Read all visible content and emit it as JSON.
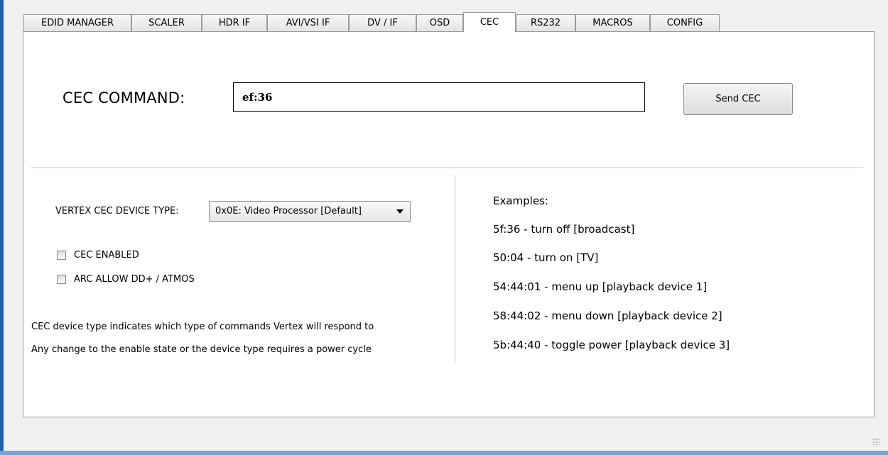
{
  "tabs": [
    {
      "label": "EDID MANAGER"
    },
    {
      "label": "SCALER"
    },
    {
      "label": "HDR IF"
    },
    {
      "label": "AVI/VSI IF"
    },
    {
      "label": "DV / IF"
    },
    {
      "label": "OSD"
    },
    {
      "label": "CEC",
      "active": true
    },
    {
      "label": "RS232"
    },
    {
      "label": "MACROS"
    },
    {
      "label": "CONFIG"
    }
  ],
  "cec_command": {
    "label": "CEC COMMAND:",
    "value": "ef:36",
    "send_label": "Send CEC"
  },
  "device_type": {
    "label": "VERTEX CEC DEVICE TYPE:",
    "selected": "0x0E: Video Processor [Default]"
  },
  "checkboxes": [
    {
      "label": "CEC ENABLED",
      "checked": false
    },
    {
      "label": "ARC ALLOW DD+ / ATMOS",
      "checked": false
    }
  ],
  "notes": [
    "CEC device type indicates which type of commands Vertex will respond to",
    "Any change to the enable state or the device type requires a power cycle"
  ],
  "examples": {
    "title": "Examples:",
    "items": [
      "5f:36 - turn off [broadcast]",
      "50:04 - turn on [TV]",
      "54:44:01 - menu up [playback device 1]",
      "58:44:02 - menu down [playback device 2]",
      "5b:44:40 - toggle power [playback device 3]"
    ]
  },
  "colors": {
    "window_frame": "#1f5fa8",
    "panel_background": "#ffffff",
    "app_background": "#f0f0f0"
  }
}
